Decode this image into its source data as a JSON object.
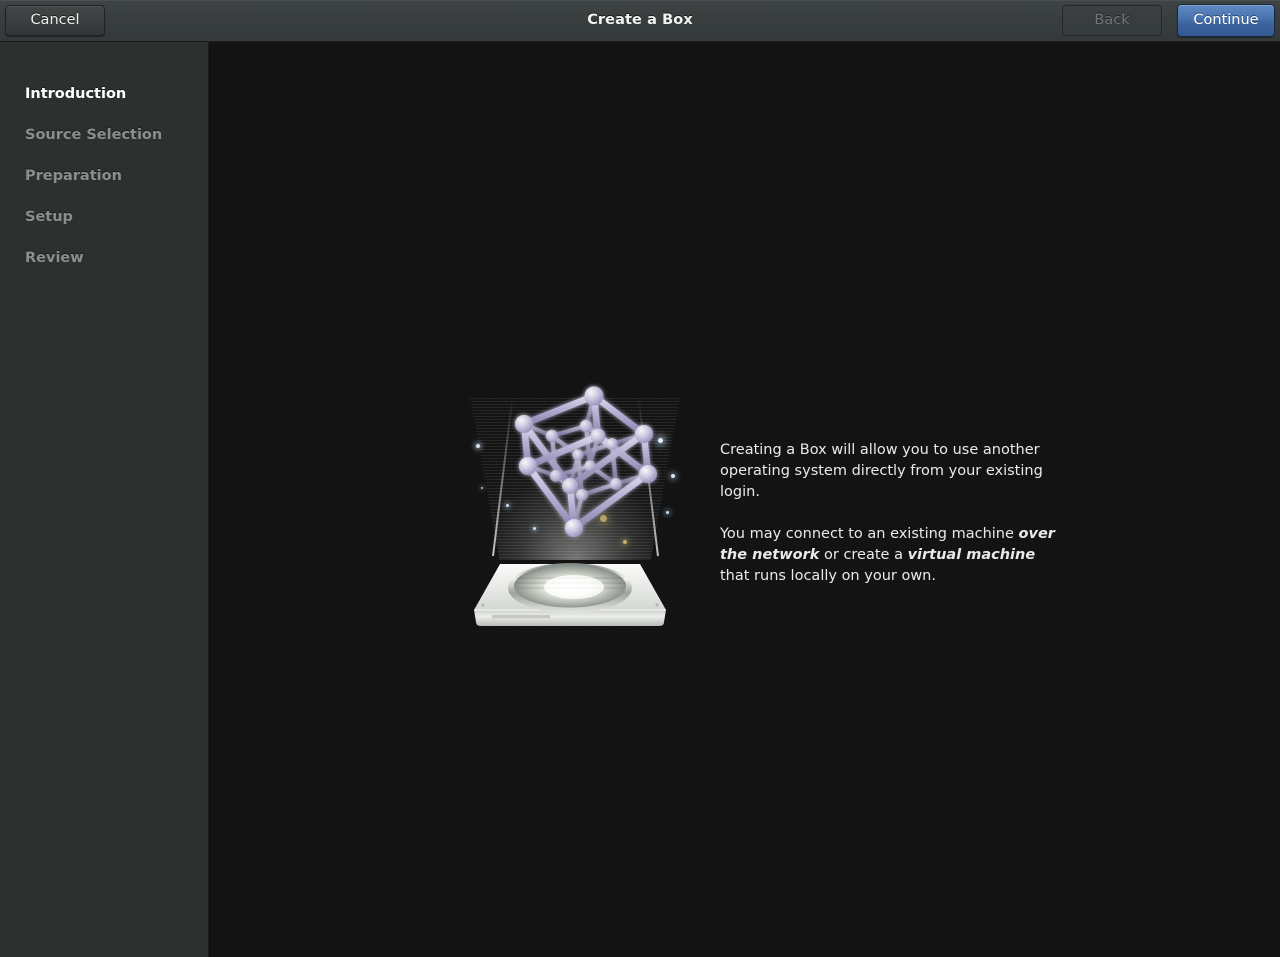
{
  "window": {
    "title": "Create a Box"
  },
  "header": {
    "title": "Create a Box",
    "cancel_label": "Cancel",
    "back_label": "Back",
    "continue_label": "Continue",
    "back_disabled": true,
    "continue_accent_color": "#4a74b0"
  },
  "sidebar": {
    "items": [
      {
        "label": "Introduction",
        "active": true
      },
      {
        "label": "Source Selection",
        "active": false
      },
      {
        "label": "Preparation",
        "active": false
      },
      {
        "label": "Setup",
        "active": false
      },
      {
        "label": "Review",
        "active": false
      }
    ]
  },
  "main": {
    "illustration": {
      "name": "holographic-projector-with-wireframe-cube",
      "hologram_color": "#b9b3dc",
      "base_color": "#e9ebe8"
    },
    "paragraph1": "Creating a Box will allow you to use another operating system directly from your existing login.",
    "paragraph2_part1": "You may connect to an existing machine ",
    "paragraph2_emphasis1": "over the network",
    "paragraph2_part2": " or create a ",
    "paragraph2_emphasis2": "virtual machine",
    "paragraph2_part3": " that runs locally on your own."
  },
  "colors": {
    "headerbar": "#393e3e",
    "sidebar": "#2c3130",
    "content": "#131313",
    "text_primary": "#e8eaea",
    "text_muted": "#8a8f8e"
  }
}
